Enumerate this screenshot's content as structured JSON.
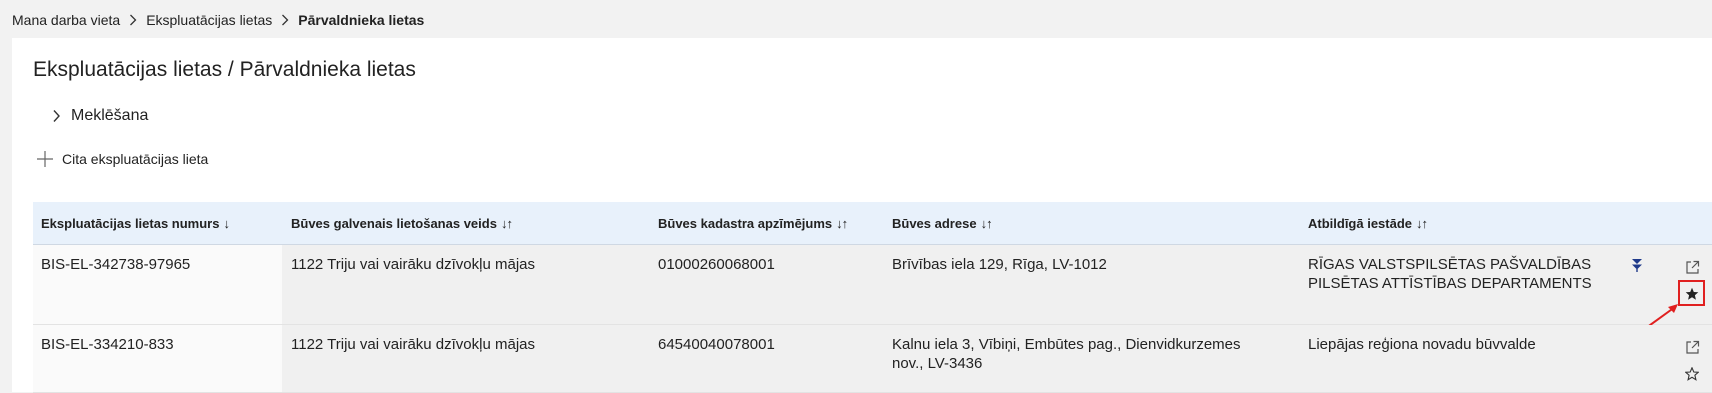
{
  "breadcrumb": {
    "items": [
      "Mana darba vieta",
      "Ekspluatācijas lietas",
      "Pārvaldnieka lietas"
    ]
  },
  "page": {
    "title": "Ekspluatācijas lietas / Pārvaldnieka lietas",
    "search_toggle": "Meklēšana",
    "add_link": "Cita ekspluatācijas lieta"
  },
  "table": {
    "columns": [
      {
        "label": "Ekspluatācijas lietas numurs",
        "sort": "↓"
      },
      {
        "label": "Būves galvenais lietošanas veids",
        "sort": "↓↑"
      },
      {
        "label": "Būves kadastra apzīmējums",
        "sort": "↓↑"
      },
      {
        "label": "Būves adrese",
        "sort": "↓↑"
      },
      {
        "label": "Atbildīgā iestāde",
        "sort": "↓↑"
      }
    ],
    "rows": [
      {
        "number": "BIS-EL-342738-97965",
        "usage": "1122 Triju vai vairāku dzīvokļu mājas",
        "cadastre": "01000260068001",
        "address": "Brīvības iela 129, Rīga, LV-1012",
        "authority": "RĪGAS VALSTSPILSĒTAS PAŠVALDĪBAS PILSĒTAS ATTĪSTĪBAS DEPARTAMENTS",
        "favorite": true,
        "pinned": true
      },
      {
        "number": "BIS-EL-334210-833",
        "usage": "1122 Triju vai vairāku dzīvokļu mājas",
        "cadastre": "64540040078001",
        "address": "Kalnu iela 3, Vībiņi, Embūtes pag., Dienvidkurzemes nov., LV-3436",
        "authority": "Liepājas reģiona novadu būvvalde",
        "favorite": false,
        "pinned": false
      }
    ]
  },
  "icons": {
    "breadcrumb_separator": "chevron-right-icon",
    "search_toggle": "chevron-right-icon",
    "add": "plus-icon",
    "pin": "pin-icon",
    "open": "open-external-icon",
    "favorite_filled": "star-filled-icon",
    "favorite_outline": "star-outline-icon"
  },
  "colors": {
    "header_bg": "#e8f1fb",
    "pin": "#1f3a8a",
    "annotation": "#e02020"
  }
}
